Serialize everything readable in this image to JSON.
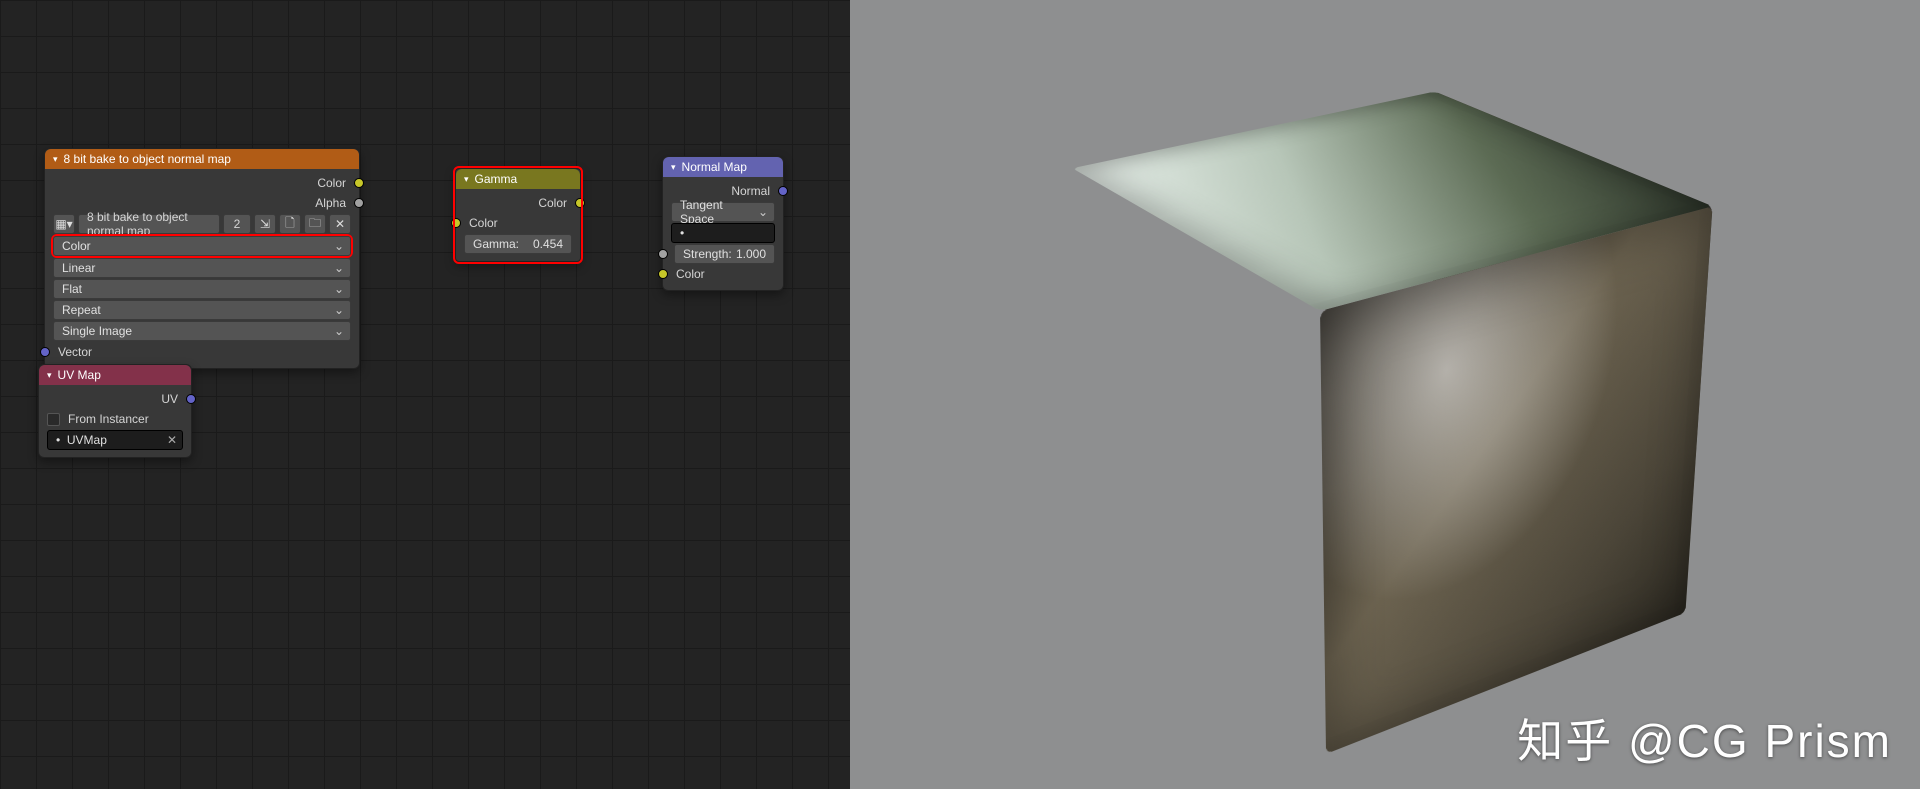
{
  "watermark": "知乎 @CG Prism",
  "texture_node": {
    "title": "8 bit bake to object normal map",
    "out_color": "Color",
    "out_alpha": "Alpha",
    "image_name": "8 bit bake to object normal map",
    "users": "2",
    "color_space": "Color",
    "interp": "Linear",
    "projection": "Flat",
    "extension": "Repeat",
    "frame_mode": "Single Image",
    "in_vector": "Vector"
  },
  "uv_node": {
    "title": "UV Map",
    "out_uv": "UV",
    "from_instancer": "From Instancer",
    "map": "UVMap"
  },
  "gamma_node": {
    "title": "Gamma",
    "out_color": "Color",
    "in_color": "Color",
    "gamma_label": "Gamma:",
    "gamma_value": "0.454"
  },
  "normal_node": {
    "title": "Normal Map",
    "out_normal": "Normal",
    "space": "Tangent Space",
    "strength_label": "Strength:",
    "strength_value": "1.000",
    "in_color": "Color"
  }
}
